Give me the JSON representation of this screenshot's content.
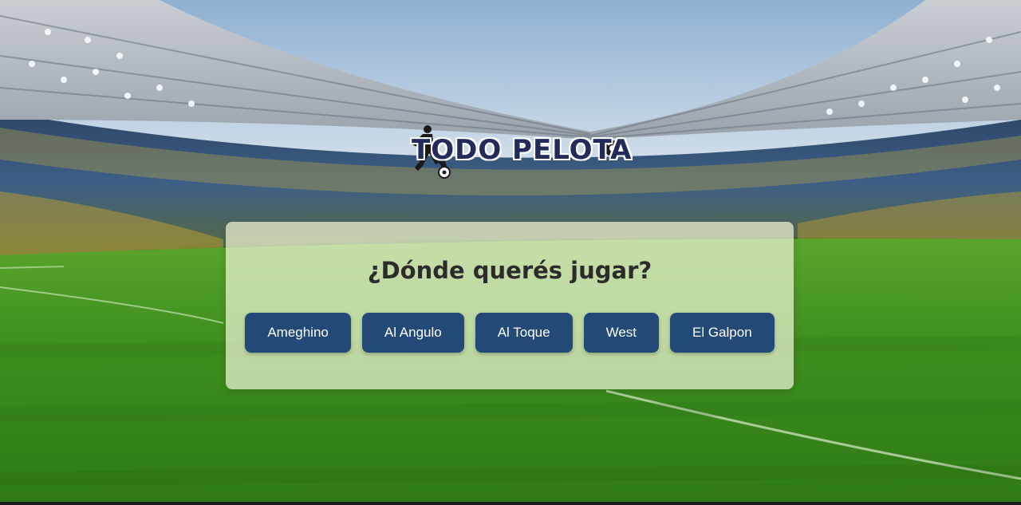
{
  "brand": {
    "logo_text": "TODO PELOTA"
  },
  "panel": {
    "title": "¿Dónde querés jugar?"
  },
  "venues": [
    {
      "label": "Ameghino"
    },
    {
      "label": "Al Angulo"
    },
    {
      "label": "Al Toque"
    },
    {
      "label": "West"
    },
    {
      "label": "El Galpon"
    }
  ],
  "colors": {
    "button_bg": "#234a77",
    "button_text": "#ffffff",
    "panel_bg": "#eef4d6",
    "logo_text": "#232b5a",
    "pitch_green": "#3f8f22"
  }
}
